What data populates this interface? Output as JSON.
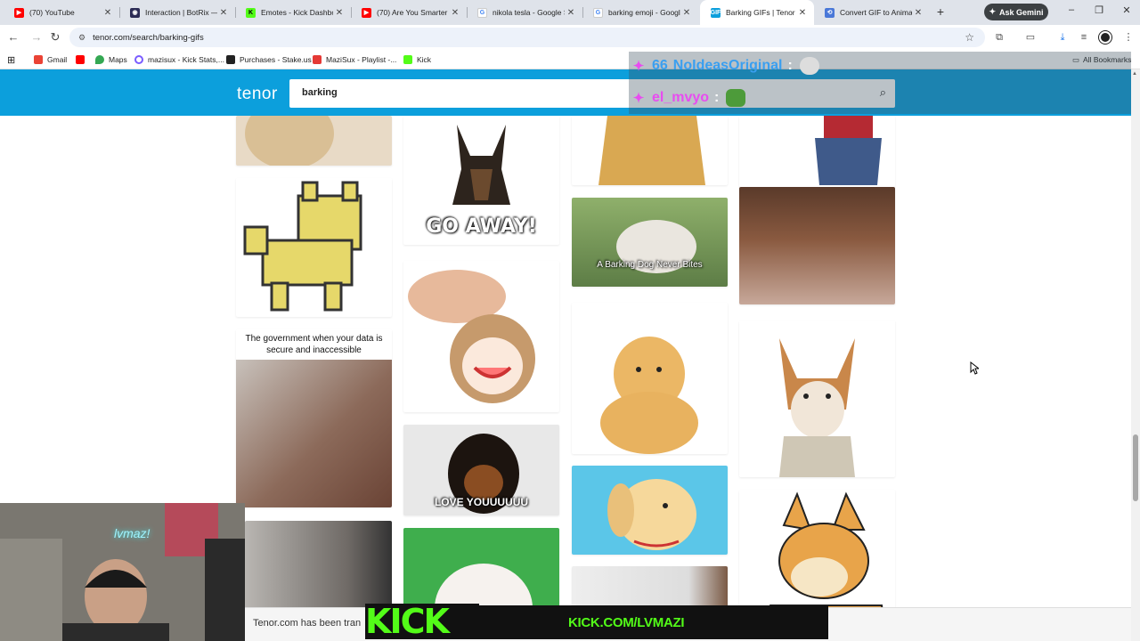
{
  "browser": {
    "tabs": [
      {
        "label": "(70) YouTube",
        "favicon_color": "#ff0000"
      },
      {
        "label": "Interaction | BotRix — ...",
        "favicon_color": "#2b2b55"
      },
      {
        "label": "Emotes - Kick Dashboa...",
        "favicon_color": "#53fc18"
      },
      {
        "label": "(70) Are You Smarter Th...",
        "favicon_color": "#ff0000"
      },
      {
        "label": "nikola tesla - Google Se...",
        "favicon_color": "#4285f4"
      },
      {
        "label": "barking emoji - Google ...",
        "favicon_color": "#4285f4"
      },
      {
        "label": "Barking GIFs | Tenor",
        "favicon_color": "#0c9fdc",
        "active": true
      },
      {
        "label": "Convert GIF to Animate...",
        "favicon_color": "#4a78d8"
      }
    ],
    "new_tab_label": "+",
    "ask_gemini_label": "Ask Gemini",
    "url": "tenor.com/search/barking-gifs",
    "bookmarks": [
      {
        "label": "Gmail",
        "color": "#ea4335"
      },
      {
        "label": "",
        "color": "#ff0000"
      },
      {
        "label": "Maps",
        "color": "#34a853"
      },
      {
        "label": "mazisux - Kick Stats,...",
        "color": "#7a5cff"
      },
      {
        "label": "Purchases - Stake.us",
        "color": "#222222"
      },
      {
        "label": "MaziSux - Playlist -...",
        "color": "#e53935"
      },
      {
        "label": "Kick",
        "color": "#53fc18"
      }
    ],
    "all_bookmarks_label": "All Bookmarks"
  },
  "tenor": {
    "logo": "tenor",
    "search_value": "barking",
    "accent": "#0c9fdc"
  },
  "stream_overlay": {
    "chat": [
      {
        "user": "NoIdeasOriginal",
        "sep": ":",
        "badge": "66"
      },
      {
        "user": "el_mvyo",
        "sep": ":"
      }
    ],
    "webcam_name": "lvmaz!",
    "kick_text": "KICK",
    "kick_url": "KICK.COM/LVMAZI",
    "notice": "Tenor.com has been tran"
  },
  "gifs": {
    "col2": {
      "go_away": "GO AWAY!",
      "love": "LOVE YOUUUUUU"
    },
    "col3": {
      "barking_dog": "A Barking Dog Never Bites"
    },
    "col1": {
      "government": "The government when your data is secure and inaccessible"
    }
  }
}
